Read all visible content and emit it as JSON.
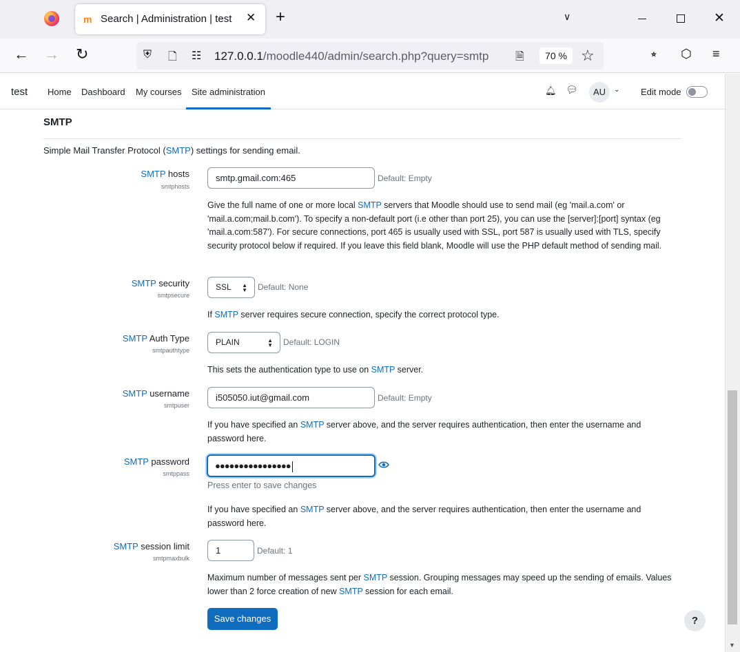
{
  "browser": {
    "tab_title": "Search | Administration | test",
    "tab_close": "✕",
    "new_tab": "+",
    "url_host": "127.0.0.1",
    "url_path": "/moodle440/admin/search.php?query=smtp",
    "zoom": "70 %"
  },
  "nav": {
    "brand": "test",
    "items": [
      "Home",
      "Dashboard",
      "My courses",
      "Site administration"
    ],
    "avatar": "AU",
    "edit_mode": "Edit mode"
  },
  "section": {
    "title": "SMTP",
    "desc_pre": "Simple Mail Transfer Protocol (",
    "desc_link": "SMTP",
    "desc_post": ") settings for sending email."
  },
  "settings": {
    "hosts": {
      "label_link": "SMTP",
      "label_rest": " hosts",
      "key": "smtphosts",
      "value": "smtp.gmail.com:465",
      "default": "Default: Empty",
      "help_1": "Give the full name of one or more local ",
      "help_link": "SMTP",
      "help_2": " servers that Moodle should use to send mail (eg 'mail.a.com' or 'mail.a.com;mail.b.com'). To specify a non-default port (i.e other than port 25), you can use the [server]:[port] syntax (eg 'mail.a.com:587'). For secure connections, port 465 is usually used with SSL, port 587 is usually used with TLS, specify security protocol below if required. If you leave this field blank, Moodle will use the PHP default method of sending mail."
    },
    "security": {
      "label_link": "SMTP",
      "label_rest": " security",
      "key": "smtpsecure",
      "value": "SSL",
      "default": "Default: None",
      "help_1": "If ",
      "help_link": "SMTP",
      "help_2": " server requires secure connection, specify the correct protocol type."
    },
    "authtype": {
      "label_link": "SMTP",
      "label_rest": " Auth Type",
      "key": "smtpauthtype",
      "value": "PLAIN",
      "default": "Default: LOGIN",
      "help_1": "This sets the authentication type to use on ",
      "help_link": "SMTP",
      "help_2": " server."
    },
    "username": {
      "label_link": "SMTP",
      "label_rest": " username",
      "key": "smtpuser",
      "value": "i505050.iut@gmail.com",
      "default": "Default: Empty",
      "help_1": "If you have specified an ",
      "help_link": "SMTP",
      "help_2": " server above, and the server requires authentication, then enter the username and password here."
    },
    "password": {
      "label_link": "SMTP",
      "label_rest": " password",
      "key": "smtppass",
      "value": "●●●●●●●●●●●●●●●●",
      "hint": "Press enter to save changes",
      "help_1": "If you have specified an ",
      "help_link": "SMTP",
      "help_2": " server above, and the server requires authentication, then enter the username and password here."
    },
    "maxbulk": {
      "label_link": "SMTP",
      "label_rest": " session limit",
      "key": "smtpmaxbulk",
      "value": "1",
      "default": "Default: 1",
      "help_1": "Maximum number of messages sent per ",
      "help_link": "SMTP",
      "help_2": " session. Grouping messages may speed up the sending of emails. Values lower than 2 force creation of new ",
      "help_link2": "SMTP",
      "help_3": " session for each email."
    }
  },
  "save_label": "Save changes",
  "help_label": "?",
  "colors": {
    "primary": "#0f6cbf",
    "text": "#1d2125",
    "muted": "#6a737b"
  }
}
